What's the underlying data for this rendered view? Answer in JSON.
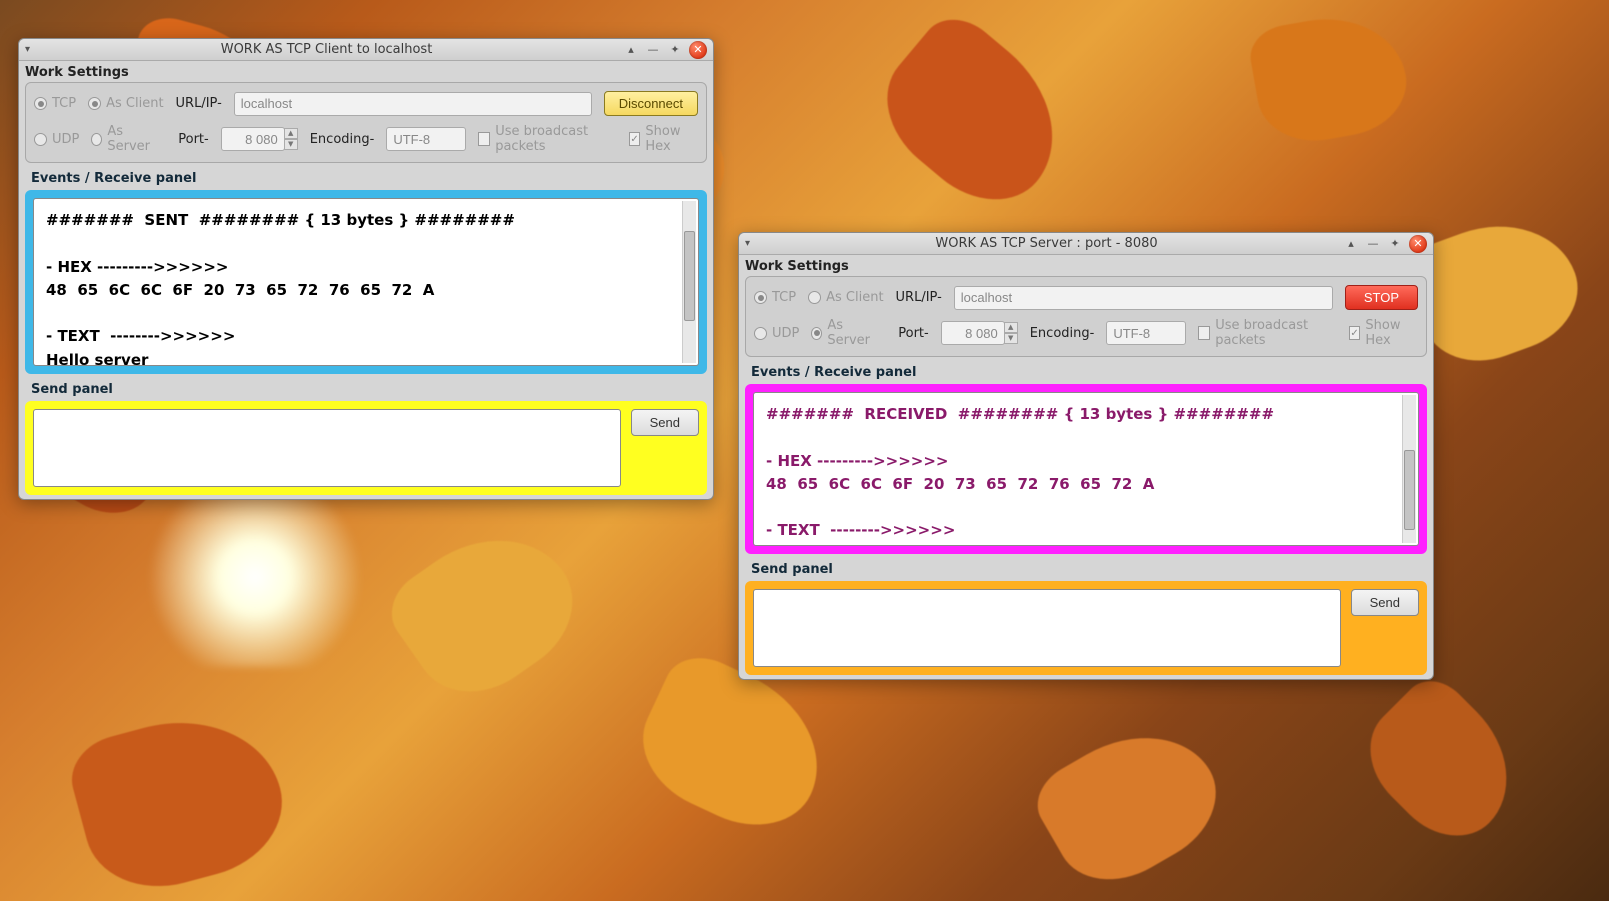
{
  "client": {
    "title": "WORK AS  TCP  Client to  localhost",
    "work_settings_label": "Work Settings",
    "radios": {
      "tcp": "TCP",
      "udp": "UDP",
      "as_client": "As Client",
      "as_server": "As Server"
    },
    "labels": {
      "url": "URL/IP-",
      "port": "Port-",
      "encoding": "Encoding-"
    },
    "url_value": "localhost",
    "port_value": "8 080",
    "encoding_value": "UTF-8",
    "use_broadcast": "Use broadcast packets",
    "show_hex": "Show Hex",
    "action_button": "Disconnect",
    "events_label": "Events / Receive panel",
    "log": "#######  SENT  ######## { 13 bytes } ########\n\n- HEX --------->>>>>>\n48  65  6C  6C  6F  20  73  65  72  76  65  72  A\n\n- TEXT  -------->>>>>>\nHello server",
    "send_label": "Send panel",
    "send_value": "",
    "send_button": "Send"
  },
  "server": {
    "title": "WORK AS  TCP  Server  : port - 8080",
    "work_settings_label": "Work Settings",
    "radios": {
      "tcp": "TCP",
      "udp": "UDP",
      "as_client": "As Client",
      "as_server": "As Server"
    },
    "labels": {
      "url": "URL/IP-",
      "port": "Port-",
      "encoding": "Encoding-"
    },
    "url_value": "localhost",
    "port_value": "8 080",
    "encoding_value": "UTF-8",
    "use_broadcast": "Use broadcast packets",
    "show_hex": "Show Hex",
    "action_button": "STOP",
    "events_label": "Events / Receive panel",
    "log": "#######  RECEIVED  ######## { 13 bytes } ########\n\n- HEX --------->>>>>>\n48  65  6C  6C  6F  20  73  65  72  76  65  72  A\n\n- TEXT  -------->>>>>>\nHello server",
    "send_label": "Send panel",
    "send_value": "",
    "send_button": "Send"
  }
}
